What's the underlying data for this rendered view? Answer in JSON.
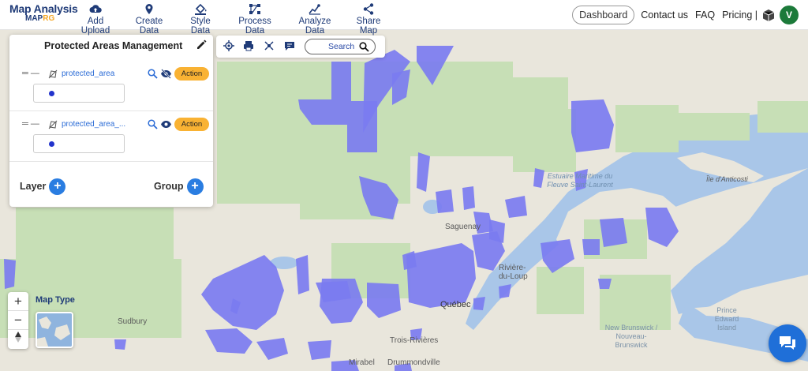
{
  "brand": {
    "line1": "Map Analysis",
    "line2a": "MAP",
    "line2b": "RG"
  },
  "nav": [
    {
      "label": "Add Upload",
      "icon": "cloud-upload-icon"
    },
    {
      "label": "Create Data",
      "icon": "location-pin-icon"
    },
    {
      "label": "Style Data",
      "icon": "paint-bucket-icon"
    },
    {
      "label": "Process Data",
      "icon": "process-nodes-icon"
    },
    {
      "label": "Analyze Data",
      "icon": "analyze-chart-icon"
    },
    {
      "label": "Share Map",
      "icon": "share-icon"
    }
  ],
  "right_nav": {
    "dashboard": "Dashboard",
    "contact": "Contact us",
    "faq": "FAQ",
    "pricing": "Pricing |",
    "avatar_letter": "V"
  },
  "panel": {
    "title": "Protected Areas Management",
    "layers": [
      {
        "name": "protected_area",
        "action": "Action",
        "visibility": "hidden"
      },
      {
        "name": "protected_area_...",
        "action": "Action",
        "visibility": "visible"
      }
    ],
    "layer_label": "Layer",
    "group_label": "Group"
  },
  "toolbar": {
    "search_label": "Search"
  },
  "map": {
    "map_type_label": "Map Type",
    "labels": [
      "Saguenay",
      "Rivière-du-Loup",
      "Québec",
      "Sudbury",
      "Trois-Rivières",
      "Drummondville",
      "Mirabel",
      "Île d'Anticosti",
      "Prince Edward Island",
      "New Brunswick / Nouveau-Brunswick"
    ],
    "water_label": "Estuaire Maritime du Fleuve Saint-Laurent",
    "polygon_color": "#7b7cf0",
    "water_color": "#a9c6e8",
    "land_color": "#e9e6dc",
    "park_color": "#c7dfb6"
  },
  "zoom": {
    "in": "+",
    "out": "−"
  },
  "colors": {
    "accent": "#1f3b78",
    "action": "#f9b233",
    "add_button": "#2a7de1",
    "avatar": "#1c7a3a",
    "chat": "#1f6fd8"
  }
}
